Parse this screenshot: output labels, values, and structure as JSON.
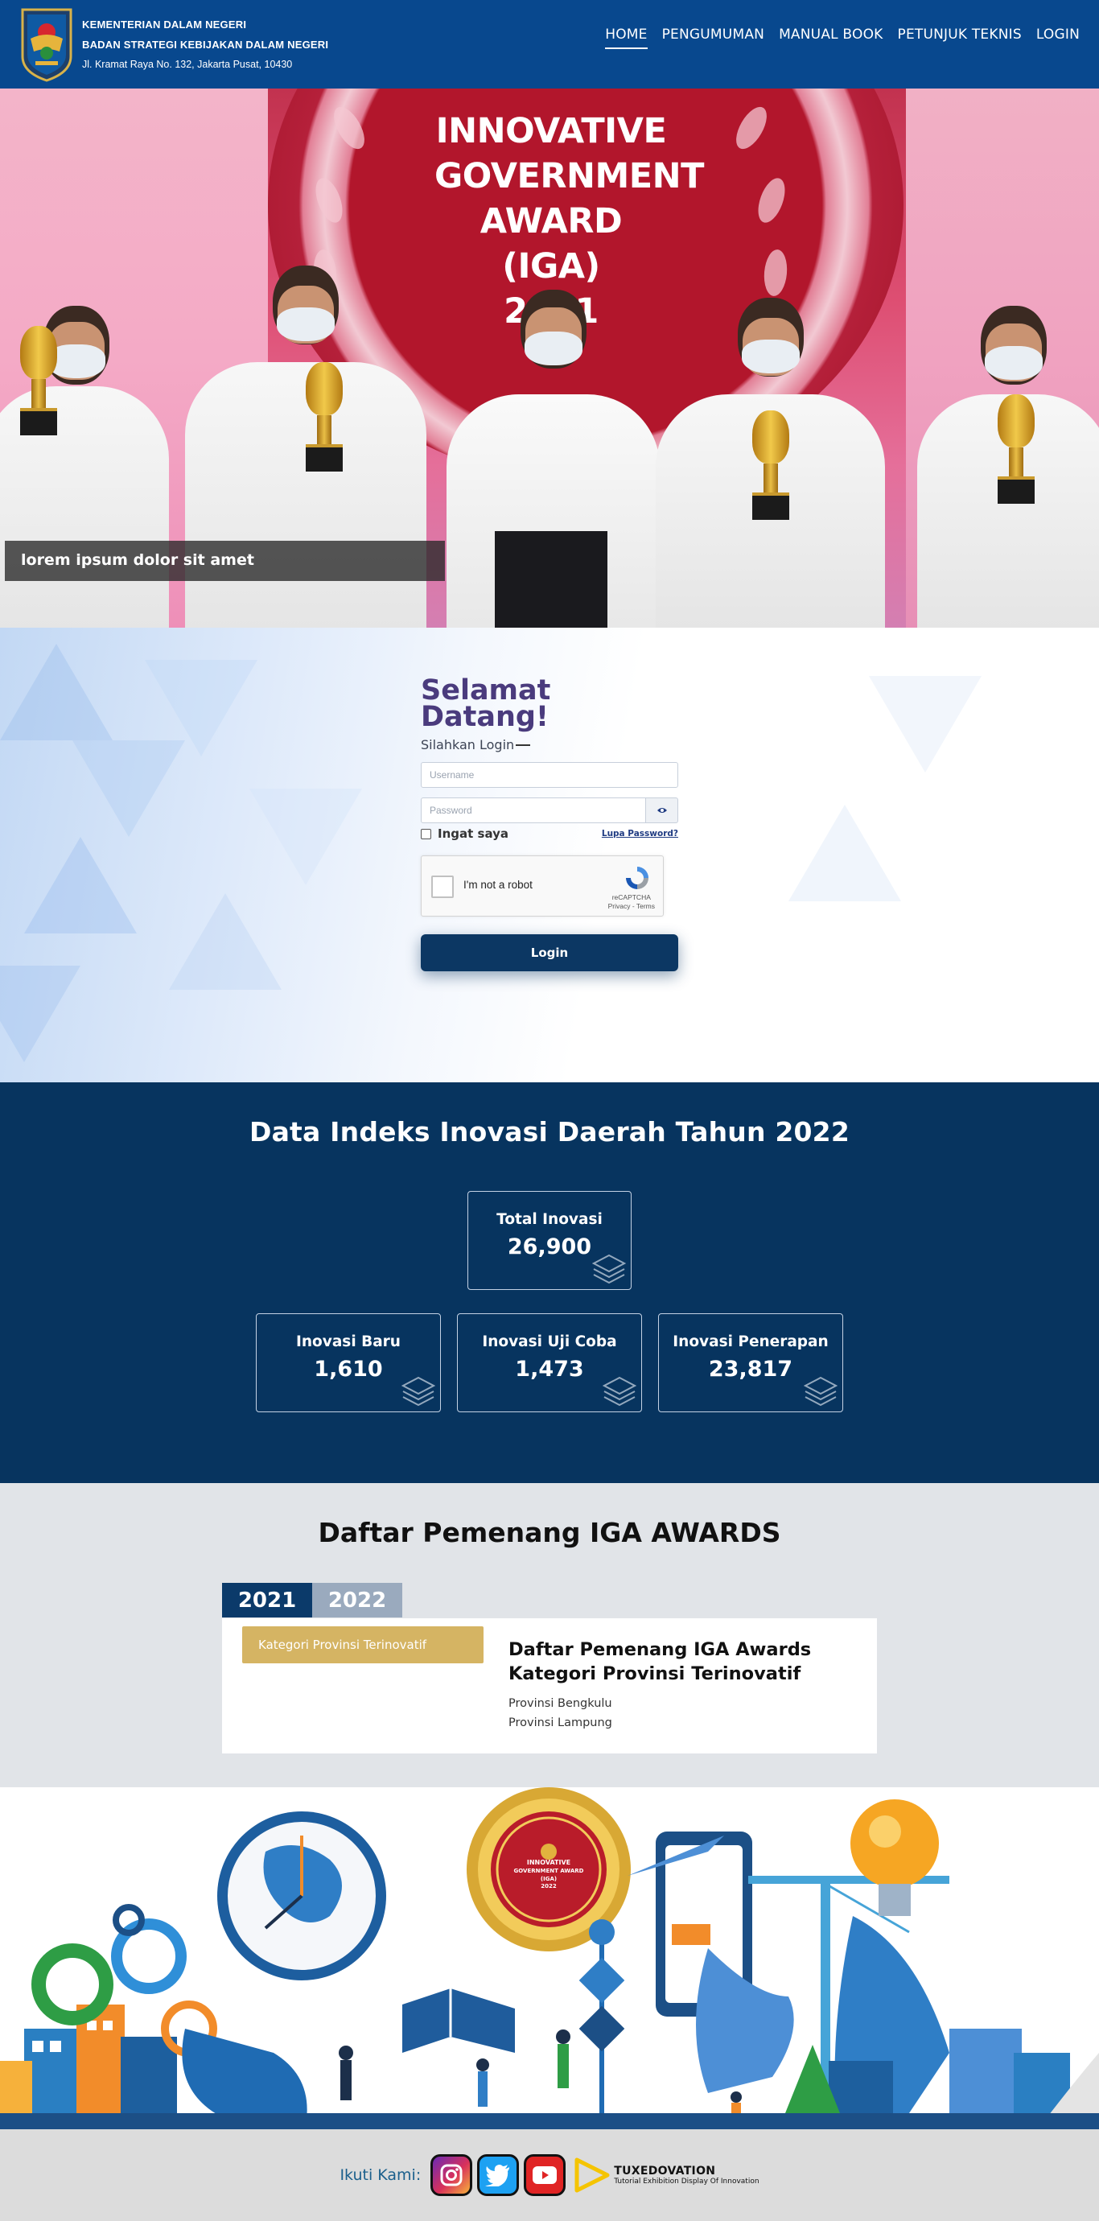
{
  "header": {
    "org_line1": "KEMENTERIAN DALAM NEGERI",
    "org_line2": "BADAN STRATEGI KEBIJAKAN DALAM NEGERI",
    "address": "Jl. Kramat Raya No. 132, Jakarta Pusat, 10430",
    "nav": [
      {
        "label": "HOME",
        "active": true
      },
      {
        "label": "PENGUMUMAN"
      },
      {
        "label": "MANUAL BOOK"
      },
      {
        "label": "PETUNJUK TEKNIS"
      },
      {
        "label": "LOGIN"
      }
    ]
  },
  "hero": {
    "banner_lines": [
      "INNOVATIVE",
      "GOVERNMENT",
      "AWARD",
      "(IGA)",
      "2021"
    ],
    "caption": "lorem ipsum dolor sit amet"
  },
  "login": {
    "title_line1": "Selamat",
    "title_line2": "Datang!",
    "subtitle": "Silahkan Login",
    "username_placeholder": "Username",
    "password_placeholder": "Password",
    "remember_label": "Ingat saya",
    "forgot_label": "Lupa Password?",
    "captcha_label": "I'm not a robot",
    "captcha_brand": "reCAPTCHA",
    "captcha_links": "Privacy - Terms",
    "button_label": "Login"
  },
  "stats": {
    "title": "Data Indeks Inovasi Daerah Tahun 2022",
    "total": {
      "label": "Total Inovasi",
      "value": "26,900"
    },
    "cards": [
      {
        "label": "Inovasi Baru",
        "value": "1,610"
      },
      {
        "label": "Inovasi Uji Coba",
        "value": "1,473"
      },
      {
        "label": "Inovasi Penerapan",
        "value": "23,817"
      }
    ]
  },
  "awards": {
    "title": "Daftar Pemenang IGA AWARDS",
    "tabs": [
      {
        "label": "2021",
        "active": true
      },
      {
        "label": "2022",
        "active": false
      }
    ],
    "category_button": "Kategori Provinsi Terinovatif",
    "list_title_line1": "Daftar Pemenang IGA Awards",
    "list_title_line2": "Kategori Provinsi Terinovatif",
    "winners": [
      "Provinsi Bengkulu",
      "Provinsi Lampung"
    ]
  },
  "illustration": {
    "medal_lines": [
      "INNOVATIVE",
      "GOVERNMENT AWARD",
      "(IGA)",
      "2022"
    ]
  },
  "footer": {
    "follow_label": "Ikuti Kami:",
    "socials": [
      "instagram-icon",
      "twitter-icon",
      "youtube-icon"
    ],
    "brand_name": "TUXEDOVATION",
    "brand_tagline": "Tutorial Exhibition Display Of Innovation"
  },
  "colors": {
    "header_bg": "#08488e",
    "stats_bg": "#07345f",
    "login_btn": "#0c3763",
    "title_purple": "#4a3b7d",
    "category_gold": "#d5b463",
    "tab_active": "#0b3a6a",
    "tab_inactive": "#9aaabe"
  }
}
